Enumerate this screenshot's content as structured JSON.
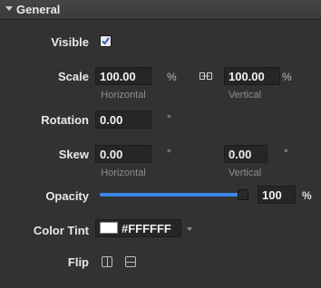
{
  "section": {
    "title": "General"
  },
  "visible": {
    "label": "Visible",
    "checked": true
  },
  "scale": {
    "label": "Scale",
    "horizontal_value": "100.00",
    "horizontal_unit": "%",
    "horizontal_caption": "Horizontal",
    "vertical_value": "100.00",
    "vertical_unit": "%",
    "vertical_caption": "Vertical"
  },
  "rotation": {
    "label": "Rotation",
    "value": "0.00",
    "unit": "°"
  },
  "skew": {
    "label": "Skew",
    "horizontal_value": "0.00",
    "horizontal_unit": "°",
    "horizontal_caption": "Horizontal",
    "vertical_value": "0.00",
    "vertical_unit": "°",
    "vertical_caption": "Vertical"
  },
  "opacity": {
    "label": "Opacity",
    "value": "100",
    "unit": "%",
    "fraction": 1.0
  },
  "color_tint": {
    "label": "Color Tint",
    "value": "#FFFFFF",
    "swatch_color": "#FFFFFF"
  },
  "flip": {
    "label": "Flip"
  },
  "colors": {
    "accent": "#3B87E8",
    "background": "#323232"
  }
}
